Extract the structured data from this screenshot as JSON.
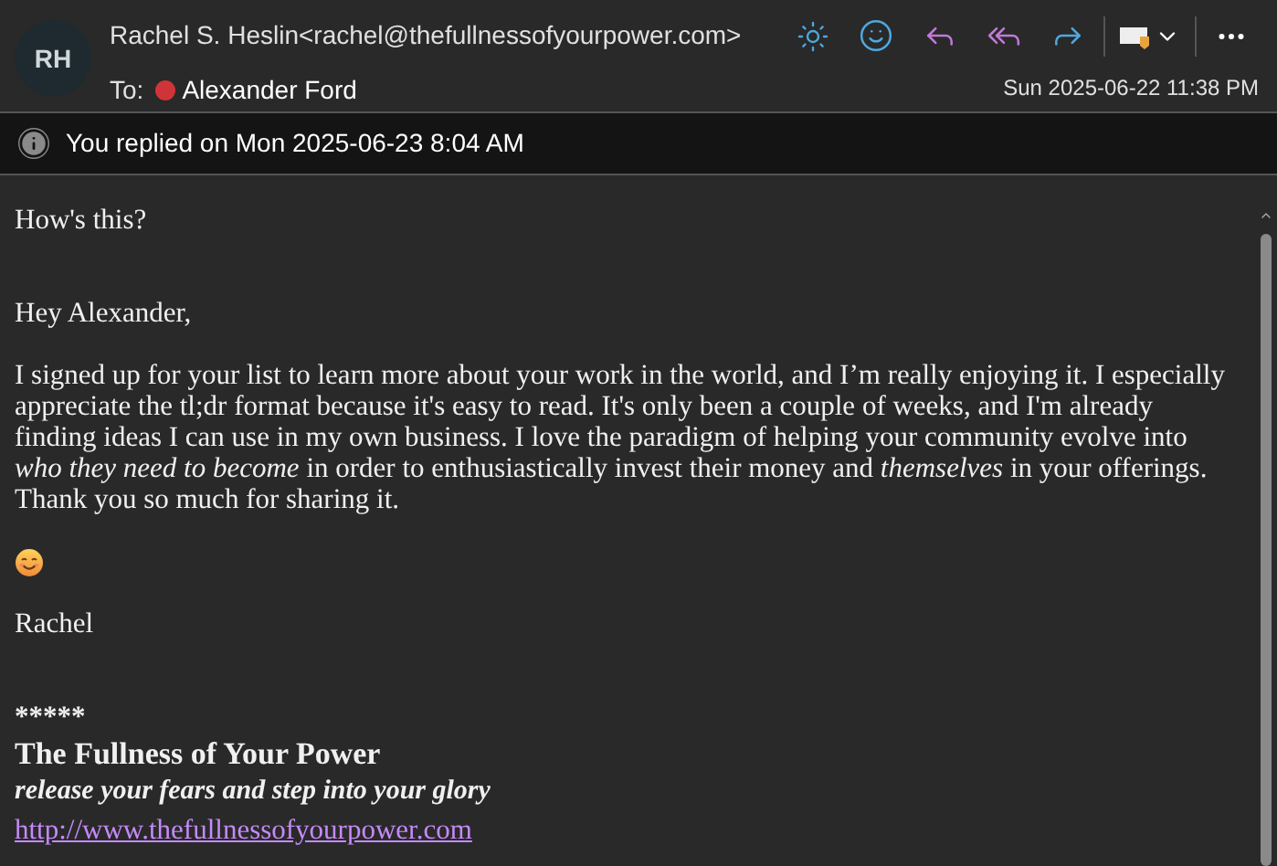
{
  "header": {
    "avatar": "RH",
    "sender": "Rachel S. Heslin<rachel@thefullnessofyourpower.com>",
    "to_label": "To:",
    "recipients": [
      {
        "name": "Alexander Ford",
        "color": "#d13438"
      }
    ],
    "date": "Sun 2025-06-22 11:38 PM"
  },
  "info_bar": {
    "text": "You replied on Mon 2025-06-23 8:04 AM"
  },
  "body": [
    {
      "kind": "text",
      "text": "How's this?"
    },
    {
      "kind": "gap"
    },
    {
      "kind": "text",
      "text": "Hey Alexander,"
    },
    {
      "kind": "text",
      "text": "I signed up for your list to learn more about your work in the world, and I’m really enjoying it. I especially appreciate the tl;dr format because it's easy to read. It's only been a couple of weeks, and I'm already finding ideas I can use in my own business. I love the paradigm of helping your community evolve into *who they need to become* in order to enthusiastically invest their money and *themselves* in your offerings. Thank you so much for sharing it."
    },
    {
      "kind": "emoji"
    },
    {
      "kind": "text",
      "text": "Rachel"
    },
    {
      "kind": "gap"
    }
  ],
  "signature": [
    {
      "kind": "line",
      "text": "*****"
    },
    {
      "kind": "title",
      "text": "The Fullness of Your Power"
    },
    {
      "kind": "tagline",
      "text": "release your fears and step into your glory"
    },
    {
      "kind": "link",
      "text": "http://www.thefullnessofyourpower.com"
    }
  ]
}
